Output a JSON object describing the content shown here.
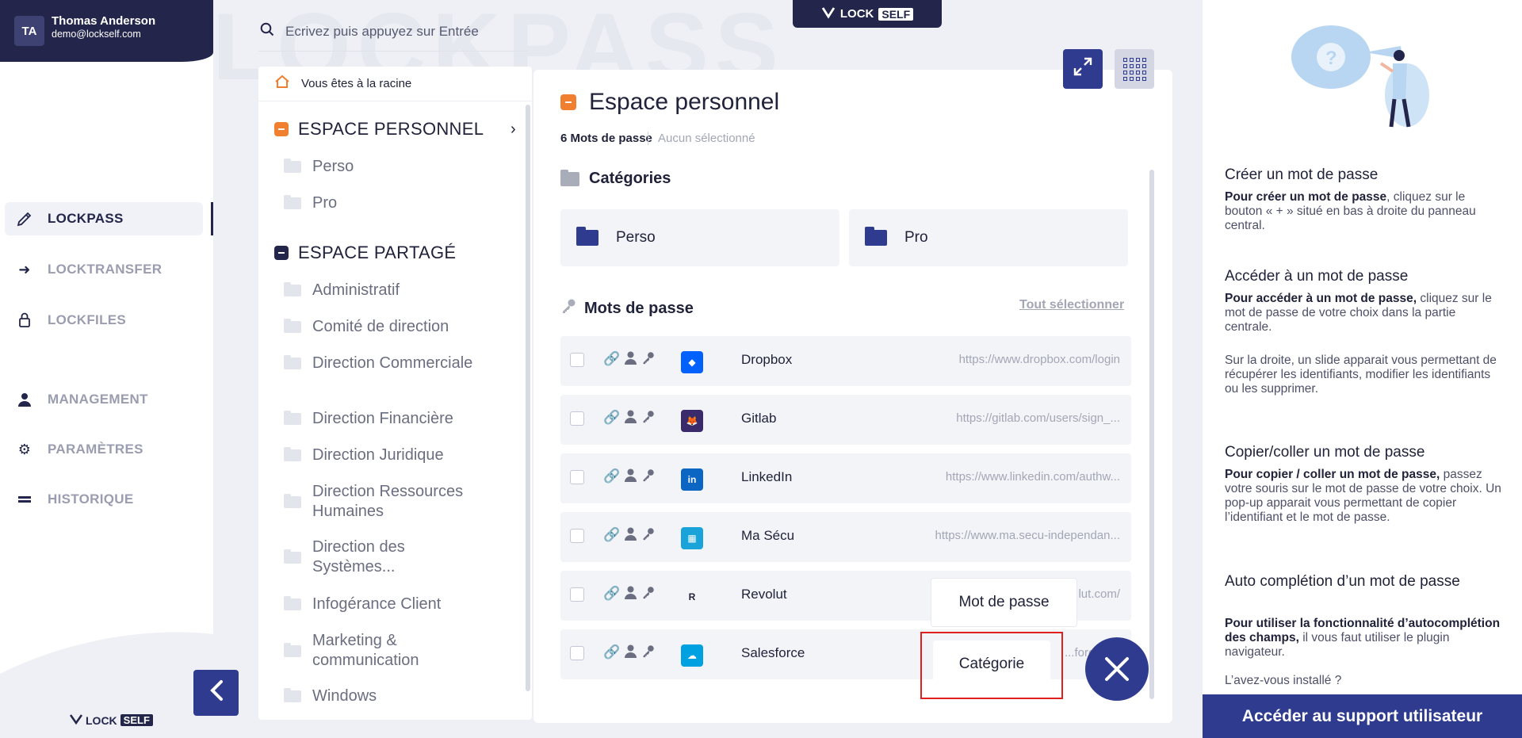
{
  "user": {
    "initials": "TA",
    "name": "Thomas Anderson",
    "email": "demo@lockself.com"
  },
  "nav": {
    "items": [
      {
        "label": "LOCKPASS",
        "icon": "pen-icon"
      },
      {
        "label": "LOCKTRANSFER",
        "icon": "arrow-right-icon"
      },
      {
        "label": "LOCKFILES",
        "icon": "lock-icon"
      },
      {
        "label": "MANAGEMENT",
        "icon": "user-icon"
      },
      {
        "label": "PARAMÈTRES",
        "icon": "gear-icon"
      },
      {
        "label": "HISTORIQUE",
        "icon": "equals-icon"
      }
    ],
    "footer_logo_lock": "LOCK",
    "footer_logo_self": "SELF"
  },
  "watermark": "LOCKPASS",
  "search": {
    "placeholder": "Ecrivez puis appuyez sur Entrée"
  },
  "top_logo": {
    "lock": "LOCK",
    "self": "SELF"
  },
  "tree": {
    "breadcrumb": "Vous êtes à la racine",
    "personal_header": "ESPACE PERSONNEL",
    "personal_items": [
      "Perso",
      "Pro"
    ],
    "shared_header": "ESPACE PARTAGÉ",
    "shared_items": [
      "Administratif",
      "Comité de direction",
      "Direction Commerciale",
      "Direction Financière",
      "Direction Juridique",
      "Direction Ressources Humaines",
      "Direction des Systèmes...",
      "Infogérance Client",
      "Marketing & communication",
      "Windows"
    ]
  },
  "main": {
    "title": "Espace personnel",
    "count": "6 Mots de passe",
    "selection": "Aucun sélectionné",
    "categories_title": "Catégories",
    "categories": [
      "Perso",
      "Pro"
    ],
    "passwords_title": "Mots de passe",
    "select_all": "Tout sélectionner",
    "passwords": [
      {
        "name": "Dropbox",
        "url": "https://www.dropbox.com/login",
        "logo_color": "#0061fe"
      },
      {
        "name": "Gitlab",
        "url": "https://gitlab.com/users/sign_...",
        "logo_color": "#3b2a6b"
      },
      {
        "name": "LinkedIn",
        "url": "https://www.linkedin.com/authw...",
        "logo_color": "#0a66c2"
      },
      {
        "name": "Ma Sécu",
        "url": "https://www.ma.secu-independan...",
        "logo_color": "#1aa3d9"
      },
      {
        "name": "Revolut",
        "url": "...lut.com/",
        "logo_color": "#20233a"
      },
      {
        "name": "Salesforce",
        "url": "...force.c...",
        "logo_color": "#00a1e0"
      }
    ]
  },
  "popup": {
    "password": "Mot de passe",
    "category": "Catégorie"
  },
  "help": {
    "sections": [
      {
        "title": "Créer un mot de passe",
        "bold": "Pour créer un mot de passe",
        "text": ", cliquez sur le bouton « + » situé en bas à droite du panneau central."
      },
      {
        "title": "Accéder à un mot de passe",
        "bold": "Pour accéder à un mot de passe,",
        "text": " cliquez sur le mot de passe de votre choix dans la partie centrale.",
        "extra": "Sur la droite, un slide apparait vous permettant de récupérer les identifiants, modifier les identifiants ou les supprimer."
      },
      {
        "title": "Copier/coller un mot de passe",
        "bold": "Pour copier / coller un mot de passe,",
        "text": " passez votre souris sur le mot de passe de votre choix. Un pop-up apparait vous permettant de copier l’identifiant et le mot de passe."
      },
      {
        "title": "Auto complétion d’un mot de passe",
        "bold": "Pour utiliser la fonctionnalité d’autocomplétion des champs,",
        "text": " il vous faut utiliser le plugin navigateur.",
        "extra": "L’avez-vous installé ?"
      }
    ],
    "support_button": "Accéder au support utilisateur"
  },
  "colors": {
    "navy": "#23264a",
    "blue": "#2f3b8f",
    "orange": "#f08030",
    "highlight": "#e0201e"
  }
}
